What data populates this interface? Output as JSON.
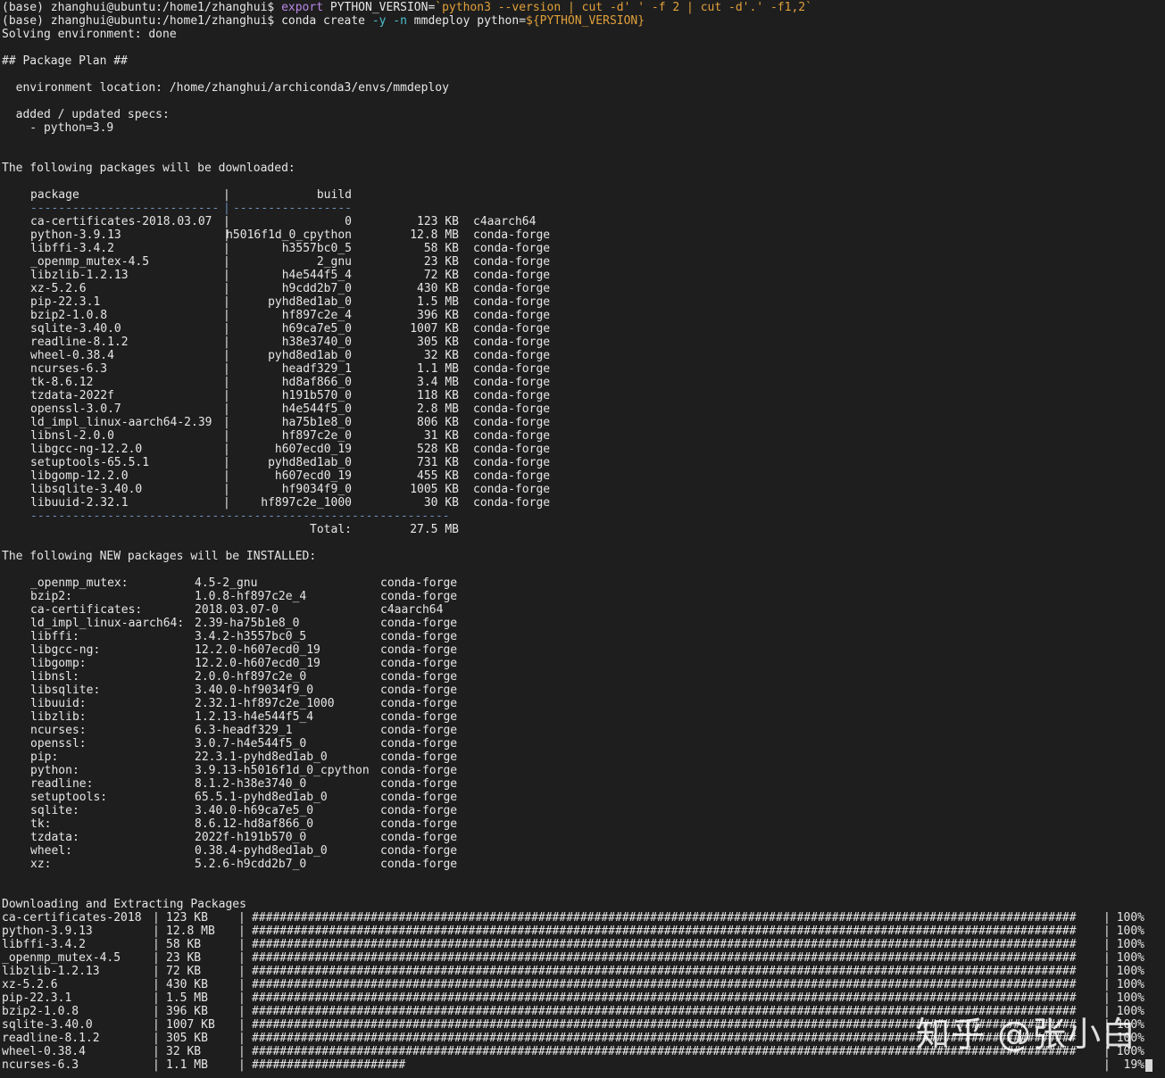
{
  "prompt": {
    "env": "(base)",
    "user_host": "zhanghui@ubuntu",
    "cwd": ":/home1/zhanghui$"
  },
  "commands": [
    {
      "segments": [
        {
          "text": "(base) zhanghui@ubuntu:/home1/zhanghui$ ",
          "color": "normal"
        },
        {
          "text": "export ",
          "color": "purple"
        },
        {
          "text": "PYTHON_VERSION=",
          "color": "normal"
        },
        {
          "text": "`python3 --version | cut -d' ' -f 2 | cut -d'.' -f1,2`",
          "color": "orange"
        }
      ]
    },
    {
      "segments": [
        {
          "text": "(base) zhanghui@ubuntu:/home1/zhanghui$ ",
          "color": "normal"
        },
        {
          "text": "conda create ",
          "color": "normal"
        },
        {
          "text": "-y -n ",
          "color": "cyan"
        },
        {
          "text": "mmdeploy python=",
          "color": "normal"
        },
        {
          "text": "${PYTHON_VERSION}",
          "color": "orange"
        }
      ]
    }
  ],
  "solving": "Solving environment: done",
  "plan_header": "## Package Plan ##",
  "env_location": "  environment location: /home/zhanghui/archiconda3/envs/mmdeploy",
  "specs_header": "  added / updated specs:",
  "specs": [
    "    - python=3.9"
  ],
  "download_header": "The following packages will be downloaded:",
  "download_table": {
    "col_package": "package",
    "col_build": "build",
    "separator_pkg": "---------------------------",
    "separator_build": "-----------------",
    "rows": [
      {
        "package": "ca-certificates-2018.03.07",
        "build": "0",
        "size": "123 KB",
        "channel": "c4aarch64"
      },
      {
        "package": "python-3.9.13",
        "build": "h5016f1d_0_cpython",
        "size": "12.8 MB",
        "channel": "conda-forge"
      },
      {
        "package": "libffi-3.4.2",
        "build": "h3557bc0_5",
        "size": "58 KB",
        "channel": "conda-forge"
      },
      {
        "package": "_openmp_mutex-4.5",
        "build": "2_gnu",
        "size": "23 KB",
        "channel": "conda-forge"
      },
      {
        "package": "libzlib-1.2.13",
        "build": "h4e544f5_4",
        "size": "72 KB",
        "channel": "conda-forge"
      },
      {
        "package": "xz-5.2.6",
        "build": "h9cdd2b7_0",
        "size": "430 KB",
        "channel": "conda-forge"
      },
      {
        "package": "pip-22.3.1",
        "build": "pyhd8ed1ab_0",
        "size": "1.5 MB",
        "channel": "conda-forge"
      },
      {
        "package": "bzip2-1.0.8",
        "build": "hf897c2e_4",
        "size": "396 KB",
        "channel": "conda-forge"
      },
      {
        "package": "sqlite-3.40.0",
        "build": "h69ca7e5_0",
        "size": "1007 KB",
        "channel": "conda-forge"
      },
      {
        "package": "readline-8.1.2",
        "build": "h38e3740_0",
        "size": "305 KB",
        "channel": "conda-forge"
      },
      {
        "package": "wheel-0.38.4",
        "build": "pyhd8ed1ab_0",
        "size": "32 KB",
        "channel": "conda-forge"
      },
      {
        "package": "ncurses-6.3",
        "build": "headf329_1",
        "size": "1.1 MB",
        "channel": "conda-forge"
      },
      {
        "package": "tk-8.6.12",
        "build": "hd8af866_0",
        "size": "3.4 MB",
        "channel": "conda-forge"
      },
      {
        "package": "tzdata-2022f",
        "build": "h191b570_0",
        "size": "118 KB",
        "channel": "conda-forge"
      },
      {
        "package": "openssl-3.0.7",
        "build": "h4e544f5_0",
        "size": "2.8 MB",
        "channel": "conda-forge"
      },
      {
        "package": "ld_impl_linux-aarch64-2.39",
        "build": "ha75b1e8_0",
        "size": "806 KB",
        "channel": "conda-forge"
      },
      {
        "package": "libnsl-2.0.0",
        "build": "hf897c2e_0",
        "size": "31 KB",
        "channel": "conda-forge"
      },
      {
        "package": "libgcc-ng-12.2.0",
        "build": "h607ecd0_19",
        "size": "528 KB",
        "channel": "conda-forge"
      },
      {
        "package": "setuptools-65.5.1",
        "build": "pyhd8ed1ab_0",
        "size": "731 KB",
        "channel": "conda-forge"
      },
      {
        "package": "libgomp-12.2.0",
        "build": "h607ecd0_19",
        "size": "455 KB",
        "channel": "conda-forge"
      },
      {
        "package": "libsqlite-3.40.0",
        "build": "hf9034f9_0",
        "size": "1005 KB",
        "channel": "conda-forge"
      },
      {
        "package": "libuuid-2.32.1",
        "build": "hf897c2e_1000",
        "size": "30 KB",
        "channel": "conda-forge"
      }
    ],
    "total_separator": "------------------------------------------------------------",
    "total_label": "Total:",
    "total_value": "27.5 MB"
  },
  "install_header": "The following NEW packages will be INSTALLED:",
  "install_rows": [
    {
      "name": "_openmp_mutex:",
      "version": "4.5-2_gnu",
      "channel": "conda-forge"
    },
    {
      "name": "bzip2:",
      "version": "1.0.8-hf897c2e_4",
      "channel": "conda-forge"
    },
    {
      "name": "ca-certificates:",
      "version": "2018.03.07-0",
      "channel": "c4aarch64"
    },
    {
      "name": "ld_impl_linux-aarch64:",
      "version": "2.39-ha75b1e8_0",
      "channel": "conda-forge"
    },
    {
      "name": "libffi:",
      "version": "3.4.2-h3557bc0_5",
      "channel": "conda-forge"
    },
    {
      "name": "libgcc-ng:",
      "version": "12.2.0-h607ecd0_19",
      "channel": "conda-forge"
    },
    {
      "name": "libgomp:",
      "version": "12.2.0-h607ecd0_19",
      "channel": "conda-forge"
    },
    {
      "name": "libnsl:",
      "version": "2.0.0-hf897c2e_0",
      "channel": "conda-forge"
    },
    {
      "name": "libsqlite:",
      "version": "3.40.0-hf9034f9_0",
      "channel": "conda-forge"
    },
    {
      "name": "libuuid:",
      "version": "2.32.1-hf897c2e_1000",
      "channel": "conda-forge"
    },
    {
      "name": "libzlib:",
      "version": "1.2.13-h4e544f5_4",
      "channel": "conda-forge"
    },
    {
      "name": "ncurses:",
      "version": "6.3-headf329_1",
      "channel": "conda-forge"
    },
    {
      "name": "openssl:",
      "version": "3.0.7-h4e544f5_0",
      "channel": "conda-forge"
    },
    {
      "name": "pip:",
      "version": "22.3.1-pyhd8ed1ab_0",
      "channel": "conda-forge"
    },
    {
      "name": "python:",
      "version": "3.9.13-h5016f1d_0_cpython",
      "channel": "conda-forge"
    },
    {
      "name": "readline:",
      "version": "8.1.2-h38e3740_0",
      "channel": "conda-forge"
    },
    {
      "name": "setuptools:",
      "version": "65.5.1-pyhd8ed1ab_0",
      "channel": "conda-forge"
    },
    {
      "name": "sqlite:",
      "version": "3.40.0-h69ca7e5_0",
      "channel": "conda-forge"
    },
    {
      "name": "tk:",
      "version": "8.6.12-hd8af866_0",
      "channel": "conda-forge"
    },
    {
      "name": "tzdata:",
      "version": "2022f-h191b570_0",
      "channel": "conda-forge"
    },
    {
      "name": "wheel:",
      "version": "0.38.4-pyhd8ed1ab_0",
      "channel": "conda-forge"
    },
    {
      "name": "xz:",
      "version": "5.2.6-h9cdd2b7_0",
      "channel": "conda-forge"
    }
  ],
  "progress_header": "Downloading and Extracting Packages",
  "progress_rows": [
    {
      "name": "ca-certificates-2018",
      "size": "123 KB",
      "percent": "100%",
      "fraction": 1.0
    },
    {
      "name": "python-3.9.13",
      "size": "12.8 MB",
      "percent": "100%",
      "fraction": 1.0
    },
    {
      "name": "libffi-3.4.2",
      "size": "58 KB",
      "percent": "100%",
      "fraction": 1.0
    },
    {
      "name": "_openmp_mutex-4.5",
      "size": "23 KB",
      "percent": "100%",
      "fraction": 1.0
    },
    {
      "name": "libzlib-1.2.13",
      "size": "72 KB",
      "percent": "100%",
      "fraction": 1.0
    },
    {
      "name": "xz-5.2.6",
      "size": "430 KB",
      "percent": "100%",
      "fraction": 1.0
    },
    {
      "name": "pip-22.3.1",
      "size": "1.5 MB",
      "percent": "100%",
      "fraction": 1.0
    },
    {
      "name": "bzip2-1.0.8",
      "size": "396 KB",
      "percent": "100%",
      "fraction": 1.0
    },
    {
      "name": "sqlite-3.40.0",
      "size": "1007 KB",
      "percent": "100%",
      "fraction": 1.0
    },
    {
      "name": "readline-8.1.2",
      "size": "305 KB",
      "percent": "100%",
      "fraction": 1.0
    },
    {
      "name": "wheel-0.38.4",
      "size": "32 KB",
      "percent": "100%",
      "fraction": 1.0
    },
    {
      "name": "ncurses-6.3",
      "size": "1.1 MB",
      "percent": "19%",
      "fraction": 0.19
    }
  ],
  "watermark": "知乎 @张小白"
}
